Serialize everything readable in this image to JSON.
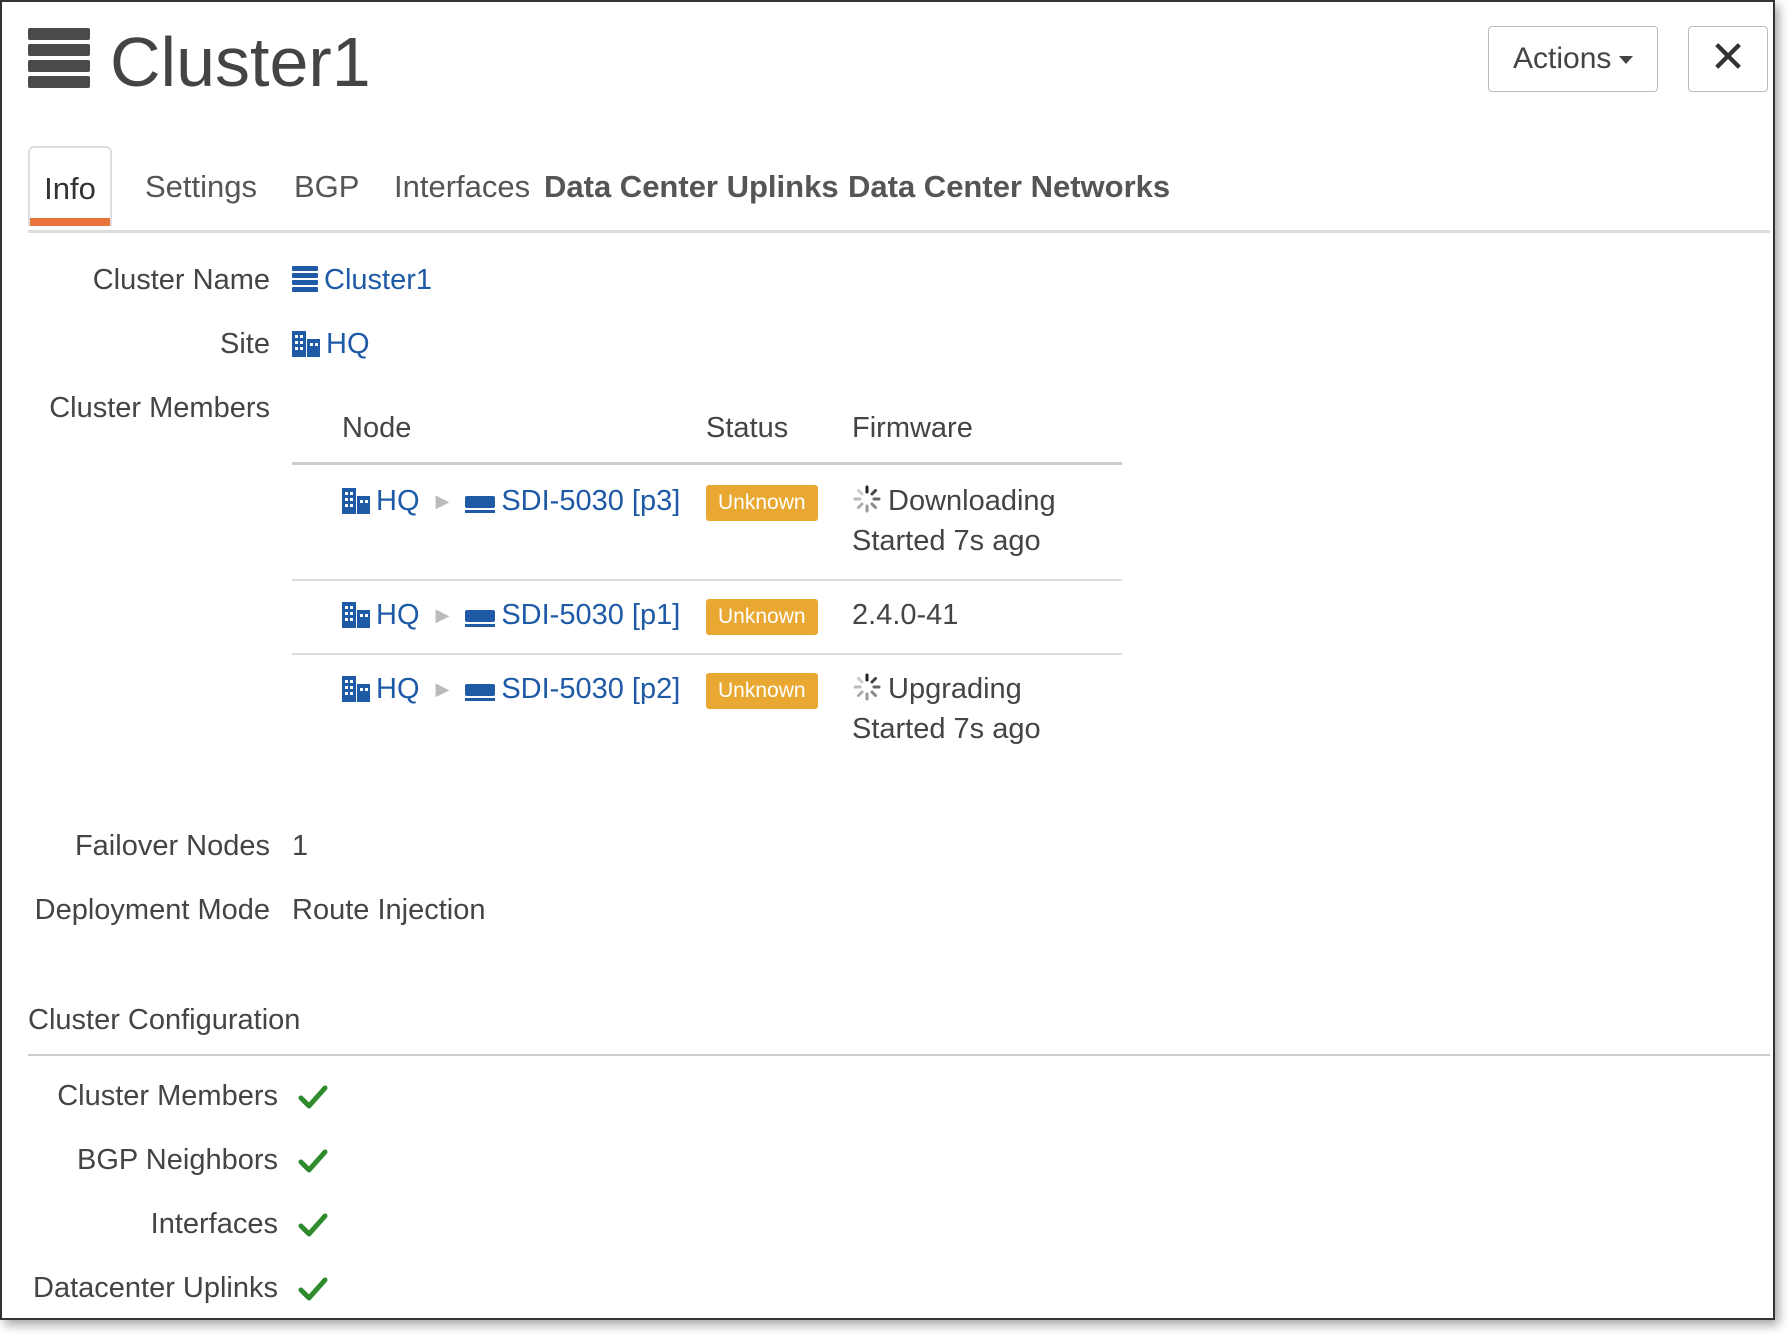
{
  "header": {
    "title": "Cluster1",
    "actions_label": "Actions",
    "close_glyph": "✕"
  },
  "tabs": [
    {
      "label": "Info",
      "active": true
    },
    {
      "label": "Settings"
    },
    {
      "label": "BGP"
    },
    {
      "label": "Interfaces"
    },
    {
      "label": "Data Center Uplinks"
    },
    {
      "label": "Data Center Networks"
    }
  ],
  "info": {
    "cluster_name_label": "Cluster Name",
    "cluster_name_value": "Cluster1",
    "site_label": "Site",
    "site_value": "HQ",
    "members_label": "Cluster Members",
    "failover_label": "Failover Nodes",
    "failover_value": "1",
    "deployment_label": "Deployment Mode",
    "deployment_value": "Route Injection"
  },
  "members_table": {
    "headers": {
      "node": "Node",
      "status": "Status",
      "firmware": "Firmware"
    },
    "rows": [
      {
        "site": "HQ",
        "node": "SDI-5030 [p3]",
        "status": "Unknown",
        "firmware_line1": "Downloading",
        "firmware_line2": "Started 7s ago",
        "spinner": true
      },
      {
        "site": "HQ",
        "node": "SDI-5030 [p1]",
        "status": "Unknown",
        "firmware_line1": "2.4.0-41",
        "firmware_line2": "",
        "spinner": false
      },
      {
        "site": "HQ",
        "node": "SDI-5030 [p2]",
        "status": "Unknown",
        "firmware_line1": "Upgrading",
        "firmware_line2": "Started 7s ago",
        "spinner": true
      }
    ]
  },
  "configuration": {
    "title": "Cluster Configuration",
    "items": [
      {
        "label": "Cluster Members",
        "ok": true
      },
      {
        "label": "BGP Neighbors",
        "ok": true
      },
      {
        "label": "Interfaces",
        "ok": true
      },
      {
        "label": "Datacenter Uplinks",
        "ok": true
      }
    ]
  },
  "colors": {
    "link": "#1f5aa6",
    "badge_unknown": "#e8a832",
    "active_tab_accent": "#e8743b",
    "check_green": "#2e8b2e"
  },
  "icons": {
    "cluster": "cluster-icon",
    "site": "building-icon",
    "node": "appliance-icon",
    "separator": "chevron-right-icon",
    "spinner": "spinner-icon",
    "check": "checkmark-icon"
  }
}
